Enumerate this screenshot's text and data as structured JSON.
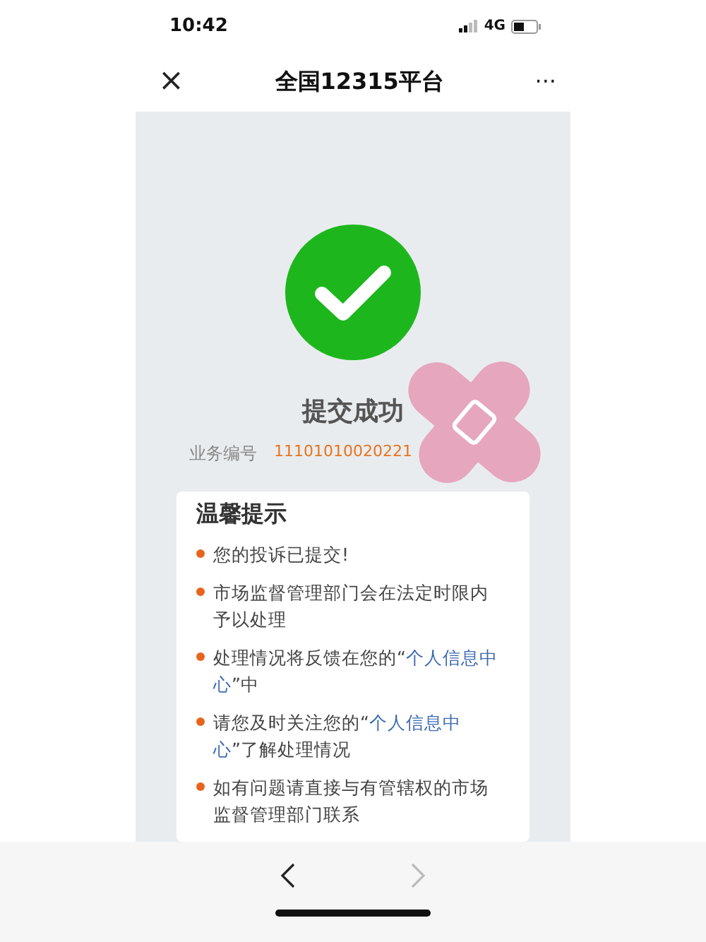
{
  "status_bar": {
    "time": "10:42",
    "network": "4G"
  },
  "nav": {
    "close": "×",
    "title": "全国12315平台",
    "more": "···"
  },
  "result": {
    "title": "提交成功",
    "number_label": "业务编号",
    "number": "11101010020221"
  },
  "tips": {
    "title": "温馨提示",
    "items": [
      [
        {
          "text": "您的投诉已提交!",
          "link": false
        }
      ],
      [
        {
          "text": "市场监督管理部门会在法定时限内予以处理",
          "link": false
        }
      ],
      [
        {
          "text": "处理情况将反馈在您的“",
          "link": false
        },
        {
          "text": "个人信息中心",
          "link": true
        },
        {
          "text": "”中",
          "link": false
        }
      ],
      [
        {
          "text": "请您及时关注您的“",
          "link": false
        },
        {
          "text": "个人信息中心",
          "link": true
        },
        {
          "text": "”了解处理情况",
          "link": false
        }
      ],
      [
        {
          "text": "如有问题请直接与有管辖权的市场监督管理部门联系",
          "link": false
        }
      ]
    ]
  },
  "toolbar": {
    "back_enabled": true,
    "forward_enabled": false
  }
}
